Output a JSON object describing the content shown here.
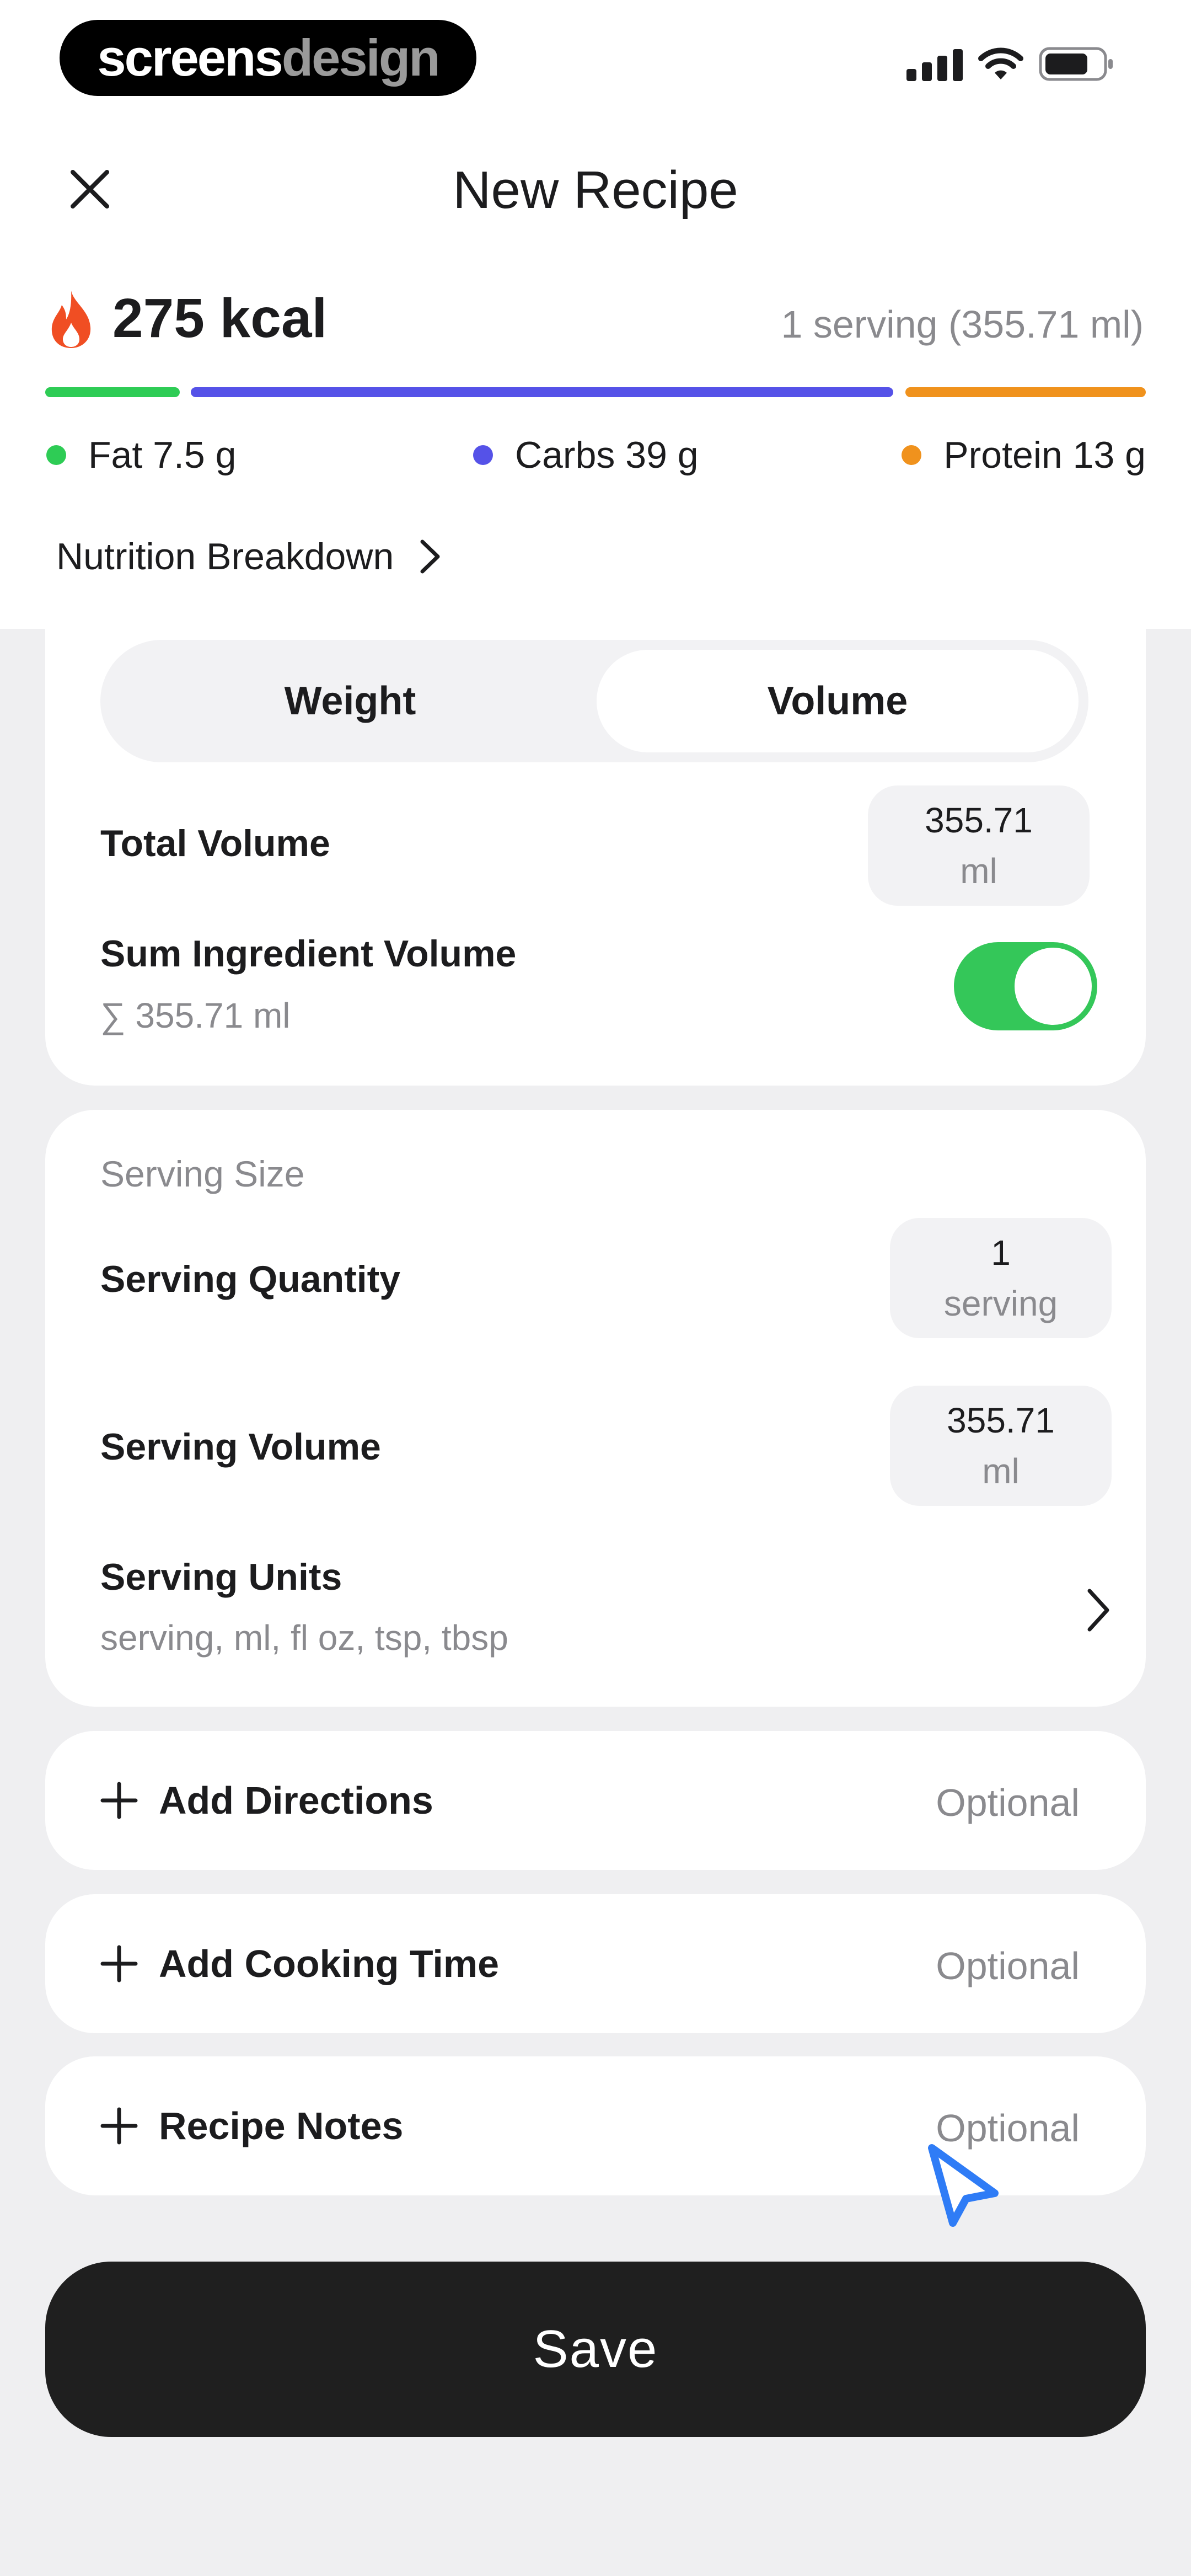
{
  "status_bar": {
    "brand_main": "screens",
    "brand_accent": "design"
  },
  "header": {
    "close_icon": "close-icon",
    "title": "New Recipe"
  },
  "summary": {
    "kcal": "275 kcal",
    "serving_info": "1 serving (355.71 ml)",
    "macros": [
      {
        "name": "Fat",
        "label": "Fat 7.5 g",
        "color": "#2ecc55",
        "share": 0.11
      },
      {
        "name": "Carbs",
        "label": "Carbs 39 g",
        "color": "#5552e8",
        "share": 0.67
      },
      {
        "name": "Protein",
        "label": "Protein 13 g",
        "color": "#f0921d",
        "share": 0.22
      }
    ],
    "nutrition_link": "Nutrition Breakdown"
  },
  "measure_card": {
    "tabs": [
      "Weight",
      "Volume"
    ],
    "active_tab": "Volume",
    "total_volume_label": "Total Volume",
    "total_volume_value": "355.71",
    "total_volume_unit": "ml",
    "sum_label": "Sum Ingredient Volume",
    "sum_sub": "∑ 355.71 ml",
    "sum_toggle_on": true
  },
  "serving_card": {
    "heading": "Serving Size",
    "quantity_label": "Serving Quantity",
    "quantity_value": "1",
    "quantity_unit": "serving",
    "volume_label": "Serving Volume",
    "volume_value": "355.71",
    "volume_unit": "ml",
    "units_label": "Serving Units",
    "units_sub": "serving, ml, fl oz, tsp, tbsp"
  },
  "optional_rows": [
    {
      "label": "Add Directions",
      "hint": "Optional"
    },
    {
      "label": "Add Cooking Time",
      "hint": "Optional"
    },
    {
      "label": "Recipe Notes",
      "hint": "Optional"
    }
  ],
  "save_label": "Save",
  "colors": {
    "accent_green": "#34c759",
    "button_dark": "#1f1f1f",
    "flame": "#f04e23"
  }
}
